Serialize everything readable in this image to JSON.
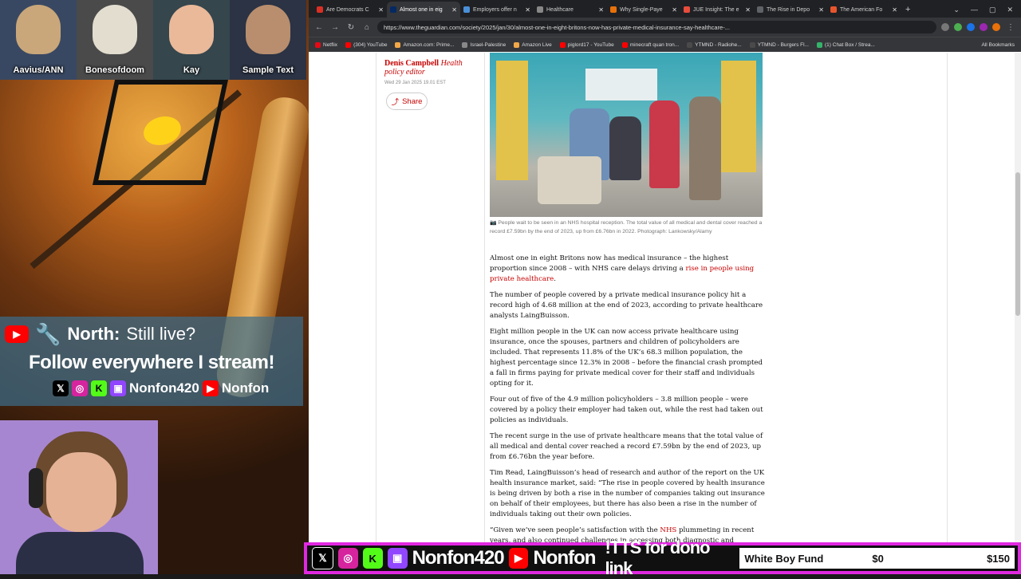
{
  "overlay": {
    "avatars": [
      {
        "name": "Aavius/ANN",
        "color": "#2f3b4f"
      },
      {
        "name": "Bonesofdoom",
        "color": "#3c3c3c"
      },
      {
        "name": "Kay",
        "color": "#2e3a40"
      },
      {
        "name": "Sample Text",
        "color": "#2a2f3a"
      }
    ],
    "chat": {
      "author": "North:",
      "message": "Still live?"
    },
    "follow_text": "Follow everywhere I stream!",
    "socials": {
      "twitch_name": "Nonfon420",
      "youtube_name": "Nonfon"
    }
  },
  "browser": {
    "tabs": [
      {
        "title": "Are Democrats C",
        "color": "#d93025",
        "active": false
      },
      {
        "title": "Almost one in eig",
        "color": "#052962",
        "active": true
      },
      {
        "title": "Employers offer n",
        "color": "#4a90d9",
        "active": false
      },
      {
        "title": "Healthcare",
        "color": "#888888",
        "active": false
      },
      {
        "title": "Why Single-Paye",
        "color": "#e8710a",
        "active": false
      },
      {
        "title": "JUE Insight: The e",
        "color": "#e84c3d",
        "active": false
      },
      {
        "title": "The Rise in Depo",
        "color": "#5f6368",
        "active": false
      },
      {
        "title": "The American Fo",
        "color": "#e8552d",
        "active": false
      }
    ],
    "url": "https://www.theguardian.com/society/2025/jan/30/almost-one-in-eight-britons-now-has-private-medical-insurance-say-healthcare-...",
    "bookmarks": [
      {
        "label": "Netflix",
        "color": "#e50914"
      },
      {
        "label": "(304) YouTube",
        "color": "#ff0000"
      },
      {
        "label": "Amazon.com: Prime...",
        "color": "#f3a847"
      },
      {
        "label": "Israel-Palestine",
        "color": "#888888"
      },
      {
        "label": "Amazon Live",
        "color": "#f3a847"
      },
      {
        "label": "piglord17 - YouTube",
        "color": "#ff0000"
      },
      {
        "label": "minecraft quan tron...",
        "color": "#ff0000"
      },
      {
        "label": "YTMND - Radiohe...",
        "color": "#4a4a4a"
      },
      {
        "label": "YTMND - Burgers Fl...",
        "color": "#4a4a4a"
      },
      {
        "label": "(1) Chat Box / Strea...",
        "color": "#35b36b"
      }
    ],
    "all_bookmarks": "All Bookmarks"
  },
  "article": {
    "author": "Denis Campbell",
    "author_role": "Health policy editor",
    "date": "Wed 29 Jan 2025 19.01 EST",
    "share_label": "Share",
    "caption": "People wait to be seen in an NHS hospital reception. The total value of all medical and dental cover reached a record £7.59bn by the end of 2023, up from £6.76bn in 2022. Photograph: Lankowsky/Alamy",
    "p1_text": "Almost one in eight Britons now has medical insurance – the highest proportion since 2008 – with NHS care delays driving a ",
    "p1_link": "rise in people using private healthcare",
    "p1_end": ".",
    "p2": "The number of people covered by a private medical insurance policy hit a record high of 4.68 million at the end of 2023, according to private healthcare analysts LaingBuisson.",
    "p3": "Eight million people in the UK can now access private healthcare using insurance, once the spouses, partners and children of policyholders are included. That represents 11.8% of the UK’s 68.3 million population, the highest percentage since 12.3% in 2008 – before the financial crash prompted a fall in firms paying for private medical cover for their staff and individuals opting for it.",
    "p4": "Four out of five of the 4.9 million policyholders – 3.8 million people – were covered by a policy their employer had taken out, while the rest had taken out policies as individuals.",
    "p5": "The recent surge in the use of private healthcare means that the total value of all medical and dental cover reached a record £7.59bn by the end of 2023, up from £6.76bn the year before.",
    "p6": "Tim Read, LaingBuisson’s head of research and author of the report on the UK health insurance market, said: “The rise in people covered by health insurance is being driven by both a rise in the number of companies taking out insurance on behalf of their employees, but there has also been a rise in the number of individuals taking out their own policies.",
    "p7_start": "“Given we’ve seen people’s satisfaction with the ",
    "p7_link": "NHS",
    "p7_end": " plummeting in recent years, and also continued challenges in accessing both diagnostic and"
  },
  "bottom_bar": {
    "twitch_name": "Nonfon420",
    "youtube_name": "Nonfon",
    "tts_text": "!TTS for dono link",
    "fund_title": "White Boy Fund",
    "fund_current": "$0",
    "fund_goal": "$150",
    "accent": "#e028e0"
  }
}
